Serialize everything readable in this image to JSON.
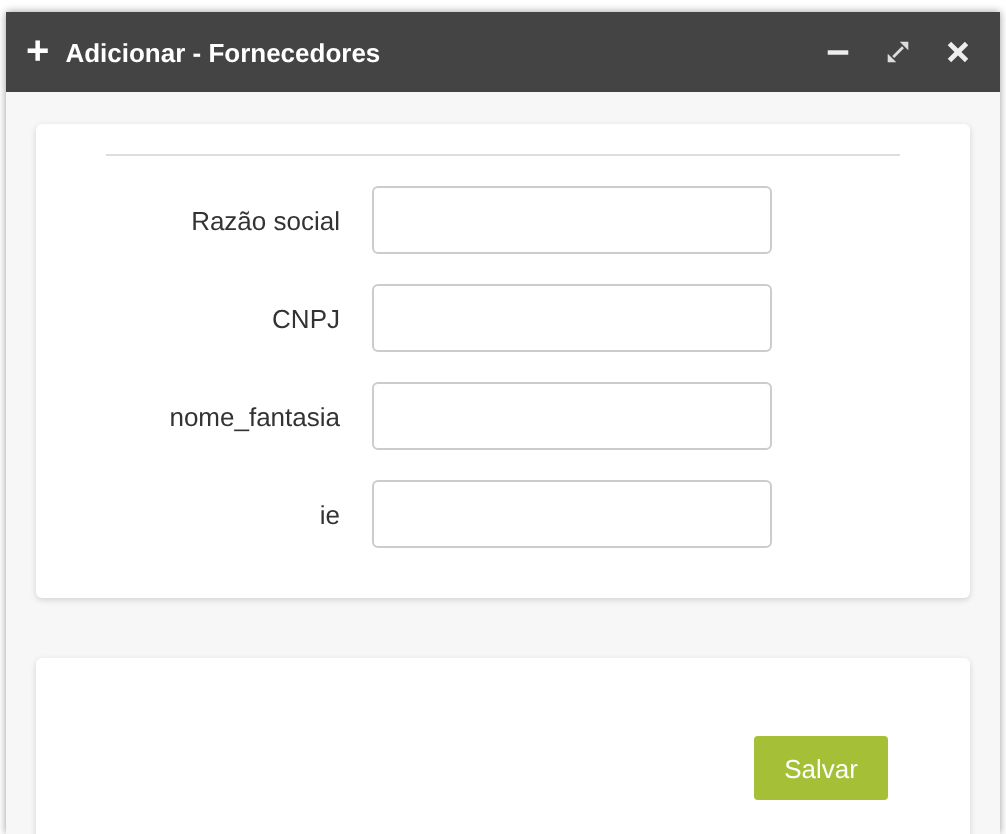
{
  "window": {
    "title": "Adicionar - Fornecedores",
    "title_icon": "+"
  },
  "fields": [
    {
      "label": "Razão social"
    },
    {
      "label": "CNPJ"
    },
    {
      "label": "nome_fantasia"
    },
    {
      "label": "ie"
    }
  ],
  "buttons": [
    {
      "label": "Salvar"
    }
  ]
}
